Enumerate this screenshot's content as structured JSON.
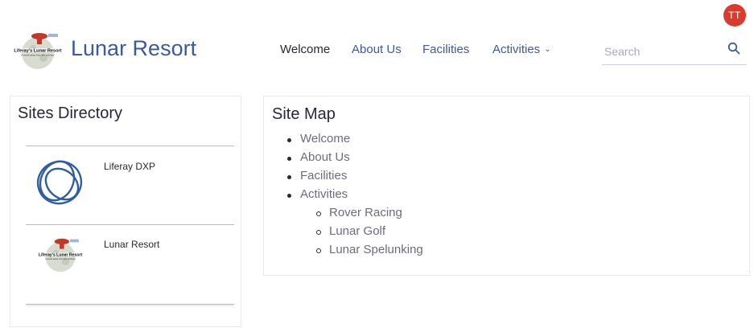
{
  "user": {
    "initials": "TT",
    "avatar_color": "#d93c2e"
  },
  "site": {
    "name": "Lunar Resort",
    "logo_text_line1": "Liferay's Lunar Resort",
    "logo_text_line2": "A world away from the ordinary"
  },
  "nav": {
    "items": [
      {
        "label": "Welcome",
        "active": true
      },
      {
        "label": "About Us"
      },
      {
        "label": "Facilities"
      },
      {
        "label": "Activities",
        "has_dropdown": true
      }
    ]
  },
  "search": {
    "placeholder": "Search"
  },
  "sites_directory": {
    "title": "Sites Directory",
    "items": [
      {
        "name": "Liferay DXP",
        "icon": "liferay-logo-icon"
      },
      {
        "name": "Lunar Resort",
        "icon": "lunar-resort-logo-icon"
      }
    ]
  },
  "site_map": {
    "title": "Site Map",
    "items": [
      {
        "label": "Welcome"
      },
      {
        "label": "About Us"
      },
      {
        "label": "Facilities"
      },
      {
        "label": "Activities",
        "children": [
          "Rover Racing",
          "Lunar Golf",
          "Lunar Spelunking"
        ]
      }
    ]
  }
}
